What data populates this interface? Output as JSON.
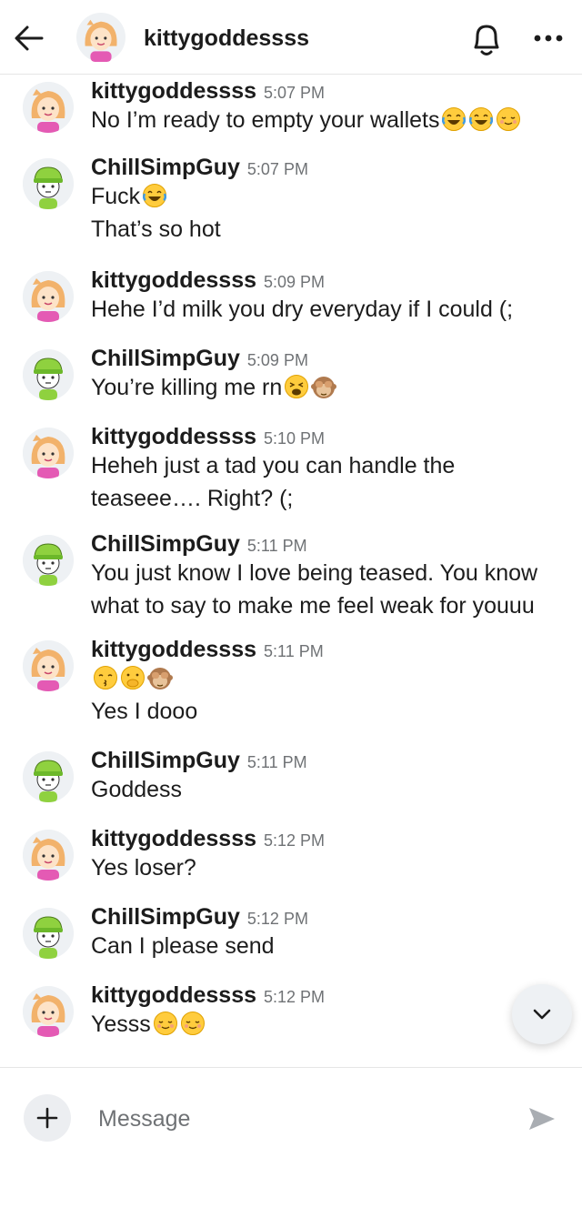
{
  "header": {
    "title": "kittygoddessss",
    "back_icon": "arrow-left-icon",
    "bell_icon": "bell-icon",
    "more_icon": "more-horizontal-icon"
  },
  "messages": [
    {
      "user": "kittygoddessss",
      "avatar": "kitty",
      "time": "5:07 PM",
      "lines": [
        {
          "text": "No I’m ready to empty your wallets",
          "emojis": [
            "laugh-cry",
            "laugh-cry",
            "relieved"
          ]
        }
      ]
    },
    {
      "user": "ChillSimpGuy",
      "avatar": "chill",
      "time": "5:07 PM",
      "lines": [
        {
          "text": "Fuck",
          "emojis": [
            "laugh-cry"
          ]
        },
        {
          "text": "That’s so hot",
          "emojis": []
        }
      ]
    },
    {
      "user": "kittygoddessss",
      "avatar": "kitty",
      "time": "5:09 PM",
      "lines": [
        {
          "text": "Hehe I’d milk you dry everyday if I could (;",
          "emojis": []
        }
      ]
    },
    {
      "user": "ChillSimpGuy",
      "avatar": "chill",
      "time": "5:09 PM",
      "lines": [
        {
          "text": "You’re killing me rn",
          "emojis": [
            "weary",
            "see-no-evil"
          ]
        }
      ]
    },
    {
      "user": "kittygoddessss",
      "avatar": "kitty",
      "time": "5:10 PM",
      "lines": [
        {
          "text": "Heheh just a tad you can handle the",
          "emojis": []
        },
        {
          "text": "teaseee…. Right? (;",
          "emojis": []
        }
      ]
    },
    {
      "user": "ChillSimpGuy",
      "avatar": "chill",
      "time": "5:11 PM",
      "lines": [
        {
          "text": "You just know I love being teased. You know",
          "emojis": []
        },
        {
          "text": "what to say to make me feel weak for youuu",
          "emojis": []
        }
      ]
    },
    {
      "user": "kittygoddessss",
      "avatar": "kitty",
      "time": "5:11 PM",
      "lines": [
        {
          "text": "",
          "emojis": [
            "kiss",
            "hand-over-mouth",
            "see-no-evil"
          ]
        },
        {
          "text": "Yes I dooo",
          "emojis": []
        }
      ]
    },
    {
      "user": "ChillSimpGuy",
      "avatar": "chill",
      "time": "5:11 PM",
      "lines": [
        {
          "text": "Goddess",
          "emojis": []
        }
      ]
    },
    {
      "user": "kittygoddessss",
      "avatar": "kitty",
      "time": "5:12 PM",
      "lines": [
        {
          "text": "Yes loser?",
          "emojis": []
        }
      ]
    },
    {
      "user": "ChillSimpGuy",
      "avatar": "chill",
      "time": "5:12 PM",
      "lines": [
        {
          "text": "Can I please send",
          "emojis": []
        }
      ]
    },
    {
      "user": "kittygoddessss",
      "avatar": "kitty",
      "time": "5:12 PM",
      "lines": [
        {
          "text": "Yesss",
          "emojis": [
            "relieved",
            "relieved"
          ]
        }
      ]
    }
  ],
  "composer": {
    "placeholder": "Message",
    "add_icon": "plus-icon",
    "send_icon": "send-icon"
  },
  "scroll_down_icon": "chevron-down-icon",
  "colors": {
    "text": "#1c1c1c",
    "timestamp": "#6f7275",
    "divider": "#e6e6e6",
    "button_bg": "#eef1f4",
    "emoji_yellow": "#ffcc3d"
  }
}
